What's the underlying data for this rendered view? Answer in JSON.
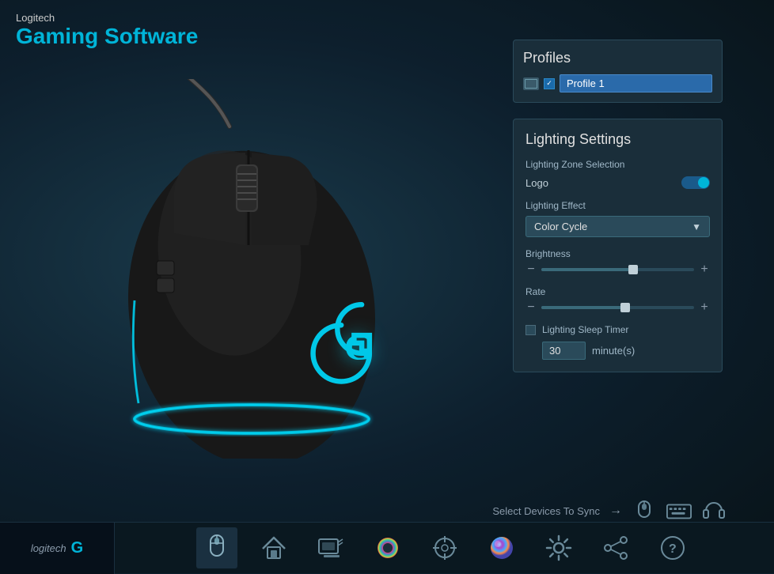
{
  "app": {
    "brand": "Logitech",
    "title": "Gaming Software"
  },
  "profiles": {
    "section_title": "Profiles",
    "active_profile": "Profile 1"
  },
  "lighting": {
    "section_title": "Lighting Settings",
    "zone_label": "Lighting Zone Selection",
    "logo_label": "Logo",
    "effect_label": "Lighting Effect",
    "effect_value": "Color Cycle",
    "brightness_label": "Brightness",
    "rate_label": "Rate",
    "sleep_timer_label": "Lighting Sleep Timer",
    "sleep_timer_value": "30",
    "sleep_timer_unit": "minute(s)"
  },
  "sync_bar": {
    "text": "Select Devices To Sync"
  },
  "taskbar": {
    "brand": "logitech",
    "items": [
      {
        "name": "mouse-icon",
        "label": "Mouse"
      },
      {
        "name": "home-icon",
        "label": "Home"
      },
      {
        "name": "profile-icon",
        "label": "Profile"
      },
      {
        "name": "spectrum-icon",
        "label": "Spectrum"
      },
      {
        "name": "crosshair-icon",
        "label": "Crosshair"
      },
      {
        "name": "aurora-icon",
        "label": "Aurora"
      },
      {
        "name": "settings-icon",
        "label": "Settings"
      },
      {
        "name": "share-icon",
        "label": "Share"
      },
      {
        "name": "help-icon",
        "label": "Help"
      }
    ]
  }
}
